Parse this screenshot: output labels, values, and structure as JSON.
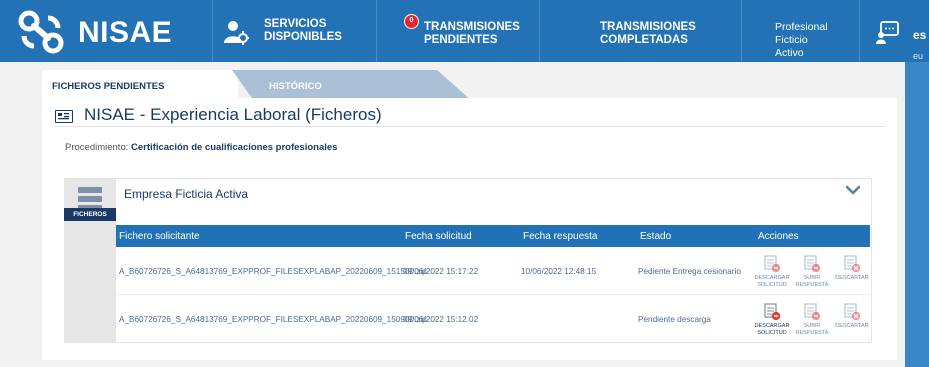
{
  "brand": {
    "name": "NISAE"
  },
  "nav": {
    "servicios": "SERVICIOS\nDISPONIBLES",
    "pendientes": "TRANSMISIONES\nPENDIENTES",
    "pendientes_badge": "0",
    "completadas": "TRANSMISIONES\nCOMPLETADAS",
    "user": "Profesional Ficticio\nActivo",
    "language": "es",
    "language_alt": "eu"
  },
  "tabs": [
    {
      "label": "FICHEROS PENDIENTES",
      "active": true
    },
    {
      "label": "HISTÓRICO",
      "active": false
    }
  ],
  "page": {
    "title": "NISAE - Experiencia Laboral (Ficheros)",
    "procedure_label": "Procedimiento:",
    "procedure_value": "Certificación de cualificaciones profesionales"
  },
  "panel": {
    "side_label": "FICHEROS",
    "company": "Empresa Ficticia Activa",
    "columns": [
      "Fichero solicitante",
      "Fecha solicitud",
      "Fecha respuesta",
      "Estado",
      "Acciones"
    ],
    "rows": [
      {
        "file": "A_B60726726_S_A64813769_EXPPROF_FILESEXPLABAP_20220609_151500.zip",
        "requested": "09/06/2022 15:17:22",
        "responded": "10/06/2022 12:48:15",
        "status": "Pediente Entrega cesionario",
        "actions": [
          "DESCARGAR\nSOLICITUD",
          "SUBIR\nRESPUESTA",
          "DESCARTAR"
        ]
      },
      {
        "file": "A_B60726726_S_A64813769_EXPPROF_FILESEXPLABAP_20220609_150900.zip",
        "requested": "09/06/2022 15:12:02",
        "responded": "",
        "status": "Pendiente descarga",
        "actions": [
          "DESCARGAR\nSOLICITUD",
          "SUBIR\nRESPUESTA",
          "DESCARTAR"
        ]
      }
    ]
  },
  "colors": {
    "primary": "#2372b6",
    "header_table": "#2171b6",
    "dark_navy": "#1a3a66",
    "badge_red": "#e3262b",
    "action_red": "#e0443f"
  }
}
